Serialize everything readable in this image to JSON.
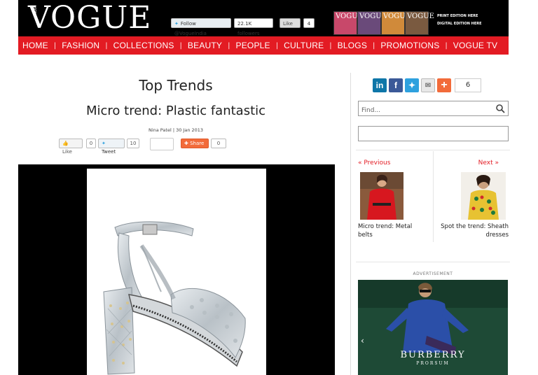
{
  "header": {
    "logo": "VOGUE",
    "logo_sub": "INDIA",
    "twitter_follow": "Follow @VogueIndia",
    "followers": "22.1K followers",
    "like_label": "Like",
    "like_count": "4",
    "cover_text": "VOGUE",
    "print_edition": "PRINT EDITION HERE",
    "digital_edition": "DIGITAL EDITION HERE"
  },
  "nav": {
    "items": [
      "HOME",
      "FASHION",
      "COLLECTIONS",
      "BEAUTY",
      "PEOPLE",
      "CULTURE",
      "BLOGS",
      "PROMOTIONS",
      "VOGUE TV"
    ]
  },
  "article": {
    "section_title": "Top Trends",
    "title": "Micro trend: Plastic fantastic",
    "byline": "Nina Patel | 30 Jan 2013",
    "share": {
      "like_label": "Like",
      "like_count": "0",
      "tweet_label": "Tweet",
      "tweet_count": "10",
      "share_label": "Share",
      "share_count": "0"
    }
  },
  "sidebar": {
    "share_count": "6",
    "find_placeholder": "Find...",
    "prev_label": "« Previous",
    "next_label": "Next »",
    "prev_caption": "Micro trend: Metal belts",
    "next_caption": "Spot the trend: Sheath dresses",
    "ad_label": "ADVERTISEMENT",
    "ad_brand": "BURBERRY",
    "ad_sub": "PRORSUM"
  },
  "colors": {
    "brand_red": "#e31b23",
    "header_bg": "#000000",
    "twitter_blue": "#2ea1de",
    "share_orange": "#f26b3a"
  },
  "icons": [
    "twitter-icon",
    "linkedin-icon",
    "facebook-icon",
    "mail-icon",
    "plus-icon",
    "search-icon",
    "chevron-left-icon"
  ]
}
